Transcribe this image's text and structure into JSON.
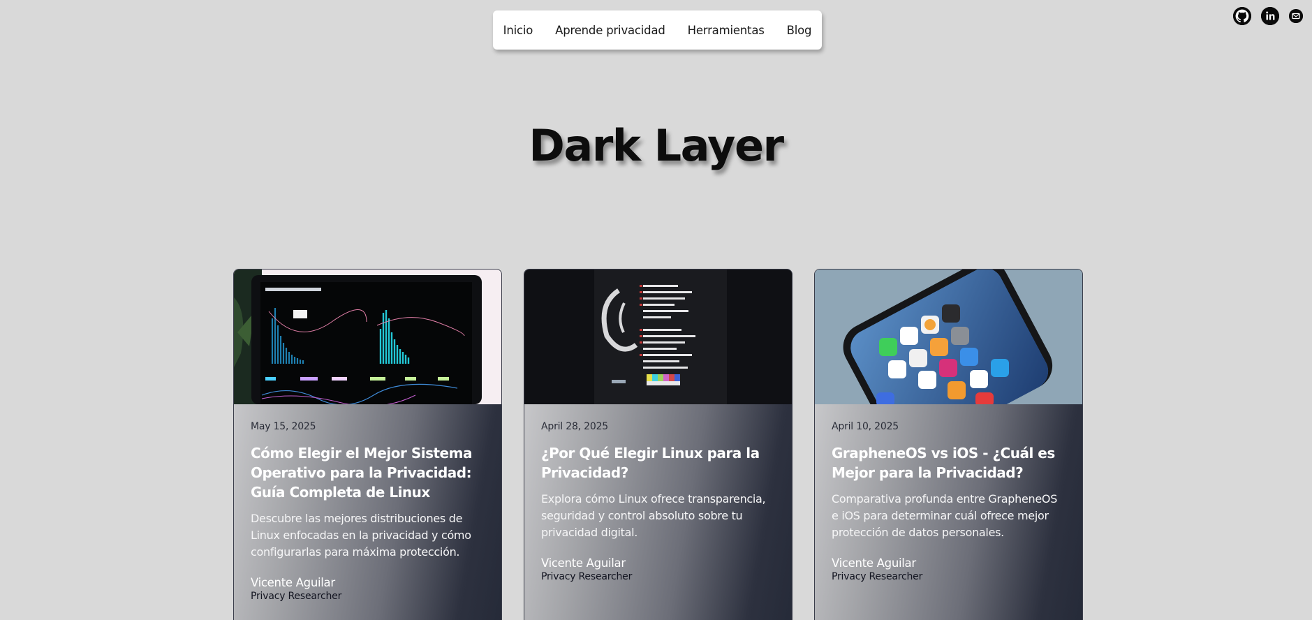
{
  "nav": {
    "items": [
      {
        "label": "Inicio"
      },
      {
        "label": "Aprende privacidad"
      },
      {
        "label": "Herramientas"
      },
      {
        "label": "Blog"
      }
    ]
  },
  "social": {
    "icons": [
      "github-icon",
      "linkedin-icon",
      "mail-icon"
    ]
  },
  "hero": {
    "title": "Dark Layer"
  },
  "posts": [
    {
      "date": "May 15, 2025",
      "title": "Cómo Elegir el Mejor Sistema Operativo para la Privacidad: Guía Completa de Linux",
      "description": "Descubre las mejores distribuciones de Linux enfocadas en la privacidad y cómo configurarlas para máxima protección.",
      "author": "Vicente Aguilar",
      "role": "Privacy Researcher",
      "image": "laptop-dashboard-image"
    },
    {
      "date": "April 28, 2025",
      "title": "¿Por Qué Elegir Linux para la Privacidad?",
      "description": "Explora cómo Linux ofrece transparencia, seguridad y control absoluto sobre tu privacidad digital.",
      "author": "Vicente Aguilar",
      "role": "Privacy Researcher",
      "image": "terminal-debian-image"
    },
    {
      "date": "April 10, 2025",
      "title": "GrapheneOS vs iOS - ¿Cuál es Mejor para la Privacidad?",
      "description": "Comparativa profunda entre GrapheneOS e iOS para determinar cuál ofrece mejor protección de datos personales.",
      "author": "Vicente Aguilar",
      "role": "Privacy Researcher",
      "image": "smartphone-homescreen-image"
    }
  ],
  "colors": {
    "background": "#d9d9d9",
    "nav_bg": "#ffffff",
    "card_border": "#3a3d4a",
    "title_color": "#0d0d0d"
  }
}
